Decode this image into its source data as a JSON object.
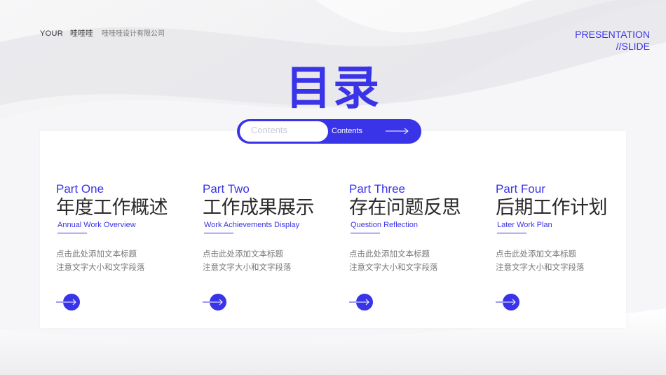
{
  "header": {
    "brand_en": "YOUR",
    "brand_cn": "哇哇哇",
    "company": "哇哇哇设计有限公司",
    "presentation_line1": "PRESENTATION",
    "presentation_line2": "//SLIDE"
  },
  "title": "目录",
  "contents_pill": {
    "ghost_label": "Contents",
    "label": "Contents"
  },
  "parts": [
    {
      "part": "Part One",
      "title": "年度工作概述",
      "subtitle": "Annual Work Overview",
      "desc_line1": "点击此处添加文本标题",
      "desc_line2": "注意文字大小和文字段落"
    },
    {
      "part": "Part Two",
      "title": "工作成果展示",
      "subtitle": "Work Achievements Display",
      "desc_line1": "点击此处添加文本标题",
      "desc_line2": "注意文字大小和文字段落"
    },
    {
      "part": "Part Three",
      "title": "存在问题反思",
      "subtitle": "Question Reflection",
      "desc_line1": "点击此处添加文本标题",
      "desc_line2": "注意文字大小和文字段落"
    },
    {
      "part": "Part Four",
      "title": "后期工作计划",
      "subtitle": "Later Work Plan",
      "desc_line1": "点击此处添加文本标题",
      "desc_line2": "注意文字大小和文字段落"
    }
  ],
  "colors": {
    "accent": "#3a34e8",
    "background": "#f2f2f4",
    "card": "#ffffff",
    "text_dark": "#2b2b2b",
    "text_muted": "#777777"
  },
  "icons": {
    "pill_arrow": "long-arrow-right-icon",
    "part_arrow": "circle-arrow-right-icon"
  }
}
